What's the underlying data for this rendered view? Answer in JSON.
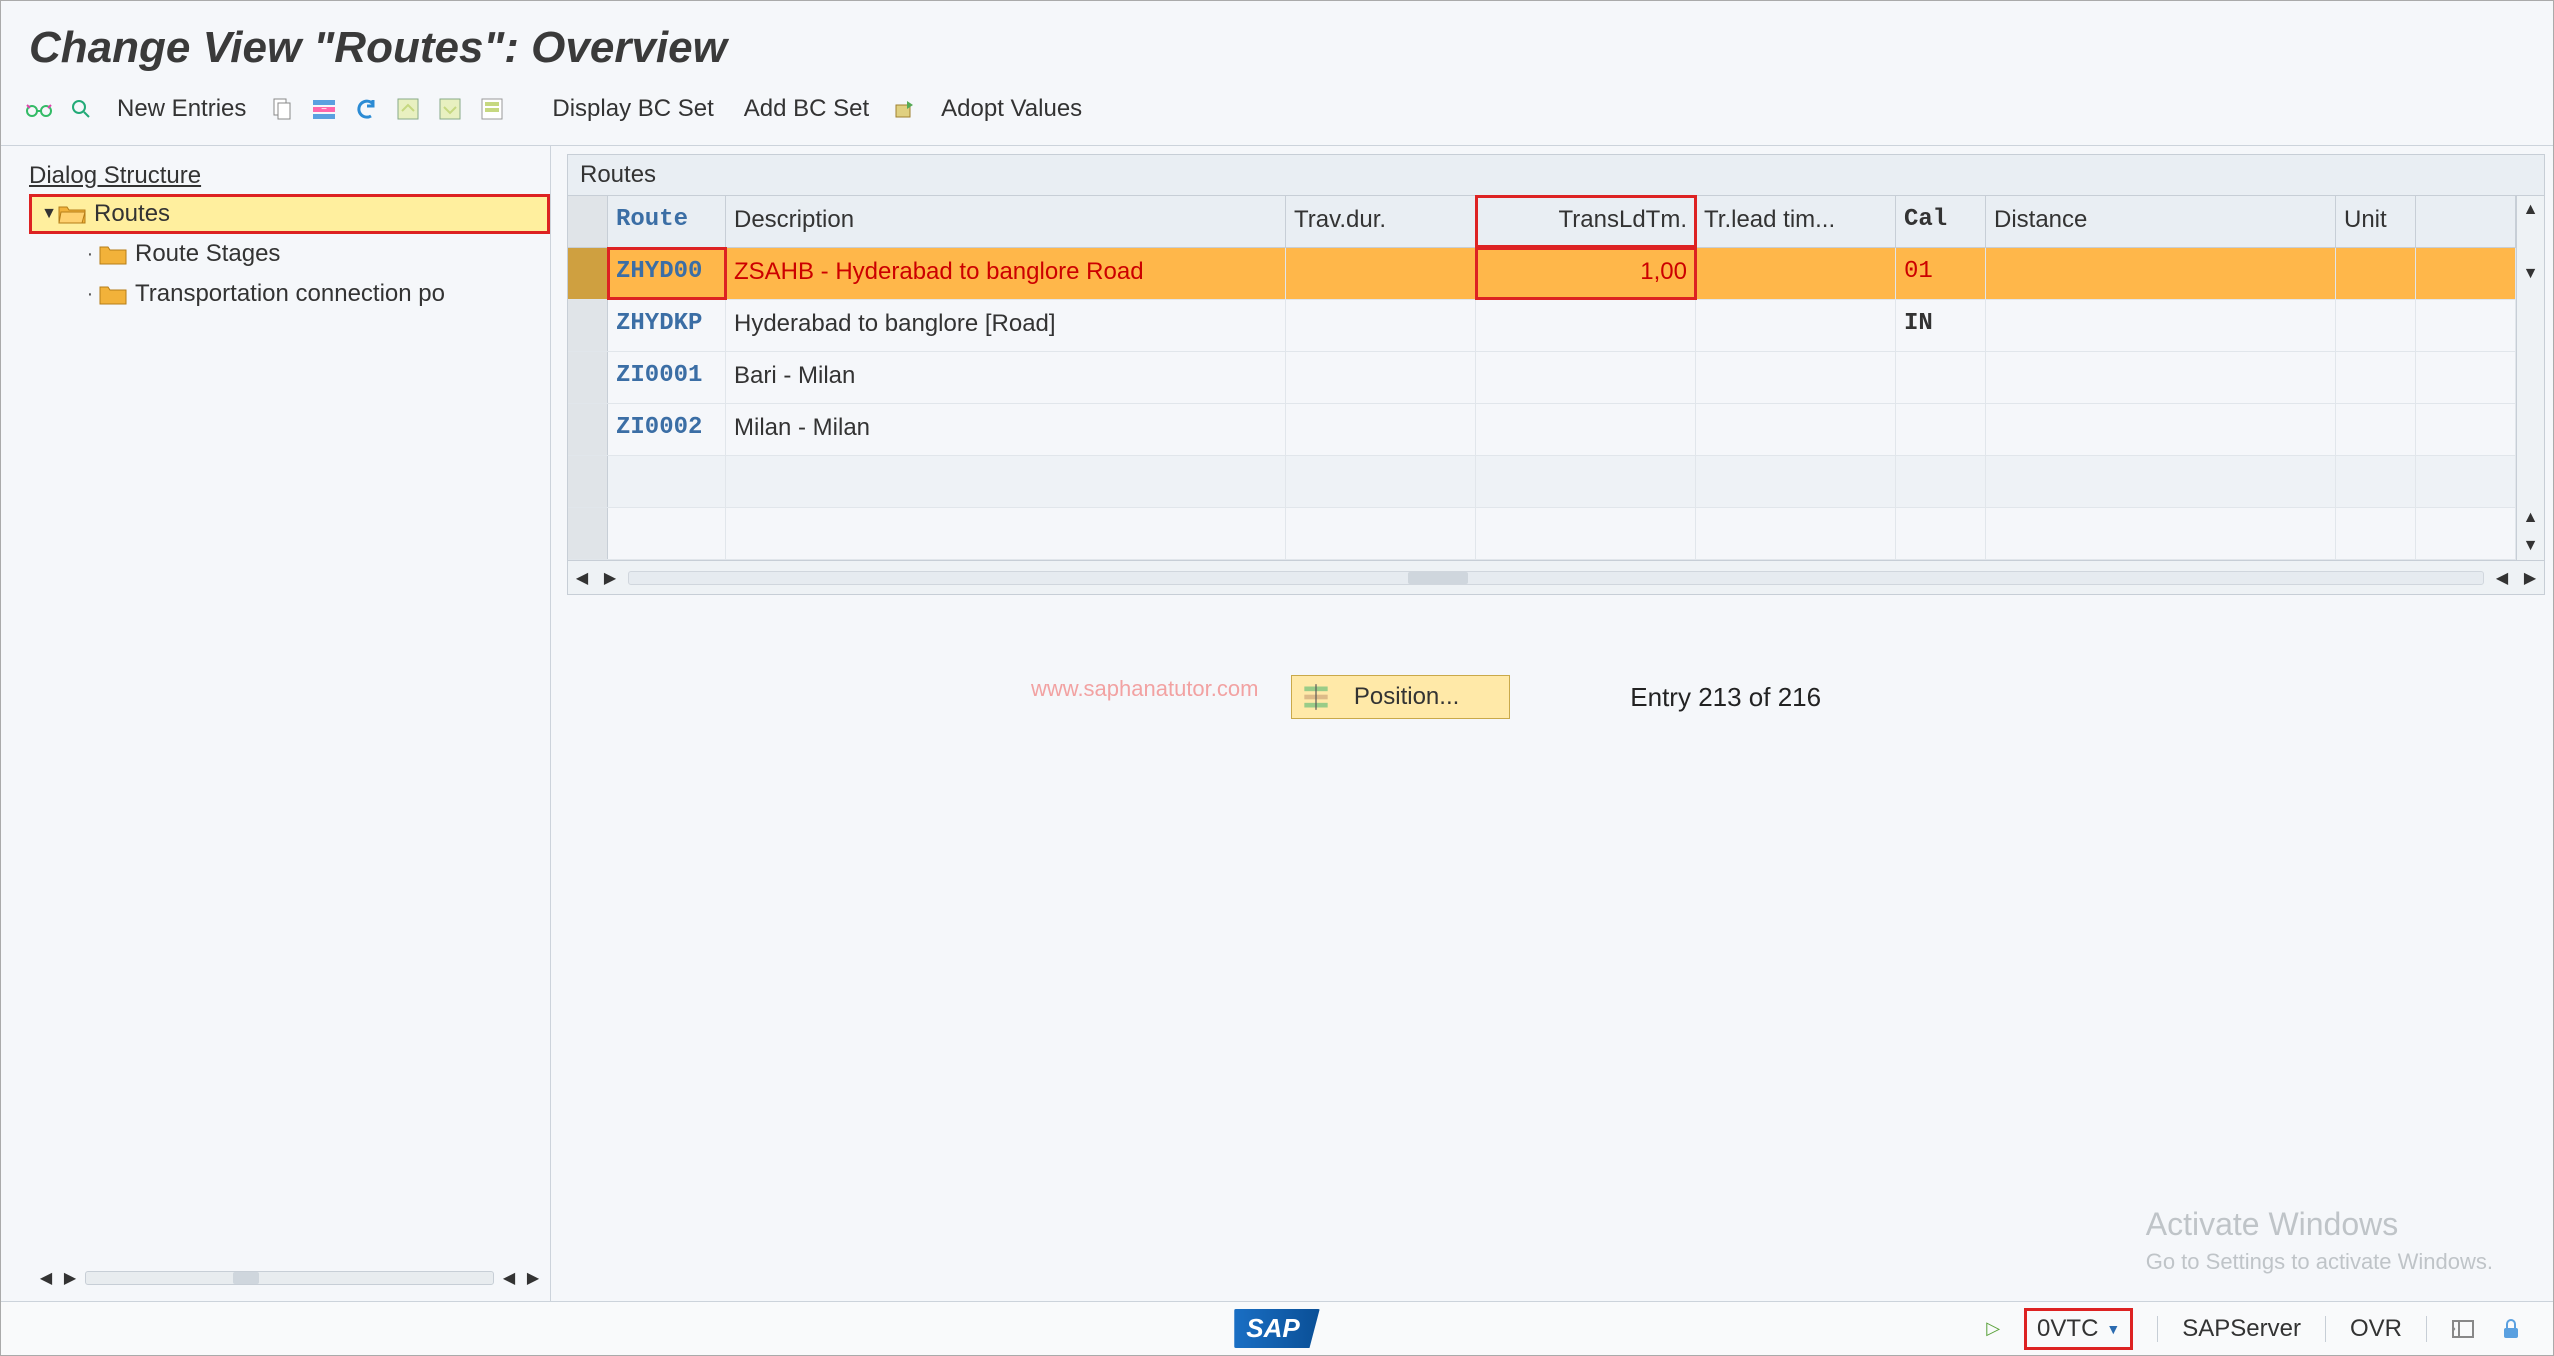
{
  "title": "Change View \"Routes\": Overview",
  "toolbar": {
    "new_entries": "New Entries",
    "display_bc_set": "Display BC Set",
    "add_bc_set": "Add BC Set",
    "adopt_values": "Adopt Values"
  },
  "tree": {
    "header": "Dialog Structure",
    "routes": "Routes",
    "route_stages": "Route Stages",
    "transport_conn": "Transportation connection po"
  },
  "grid": {
    "title": "Routes",
    "columns": {
      "route": "Route",
      "description": "Description",
      "trav": "Trav.dur.",
      "transldtm": "TransLdTm.",
      "trlead": "Tr.lead tim...",
      "cal": "Cal",
      "distance": "Distance",
      "unit": "Unit"
    },
    "rows": [
      {
        "route": "ZHYD00",
        "description": "ZSAHB - Hyderabad to banglore Road",
        "trav": "",
        "transldtm": "1,00",
        "trlead": "",
        "cal": "01",
        "distance": "",
        "unit": "",
        "selected": true
      },
      {
        "route": "ZHYDKP",
        "description": "Hyderabad to banglore [Road]",
        "trav": "",
        "transldtm": "",
        "trlead": "",
        "cal": "IN",
        "distance": "",
        "unit": "",
        "selected": false
      },
      {
        "route": "ZI0001",
        "description": "Bari - Milan",
        "trav": "",
        "transldtm": "",
        "trlead": "",
        "cal": "",
        "distance": "",
        "unit": "",
        "selected": false
      },
      {
        "route": "ZI0002",
        "description": "Milan - Milan",
        "trav": "",
        "transldtm": "",
        "trlead": "",
        "cal": "",
        "distance": "",
        "unit": "",
        "selected": false
      }
    ]
  },
  "position_button": "Position...",
  "entry_info": "Entry 213 of 216",
  "watermark": "www.saphanatutor.com",
  "activate": {
    "title": "Activate Windows",
    "sub": "Go to Settings to activate Windows."
  },
  "status": {
    "session": "0VTC",
    "server": "SAPServer",
    "mode": "OVR"
  },
  "sap_logo": "SAP"
}
